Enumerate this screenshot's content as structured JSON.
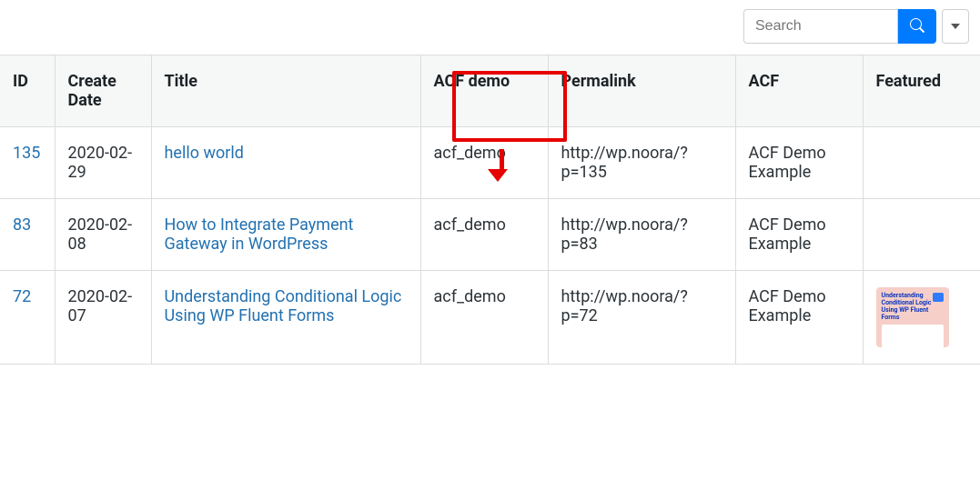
{
  "search": {
    "placeholder": "Search"
  },
  "columns": {
    "id": "ID",
    "create_date": "Create Date",
    "title": "Title",
    "acf_demo": "ACF demo",
    "permalink": "Permalink",
    "acf": "ACF",
    "featured": "Featured"
  },
  "rows": [
    {
      "id": "135",
      "create_date": "2020-02-29",
      "title": "hello world",
      "acf_demo": "acf_demo",
      "permalink": "http://wp.noora/?p=135",
      "acf": "ACF Demo Example",
      "featured_thumb_text": ""
    },
    {
      "id": "83",
      "create_date": "2020-02-08",
      "title": "How to Integrate Payment Gateway in WordPress",
      "acf_demo": "acf_demo",
      "permalink": "http://wp.noora/?p=83",
      "acf": "ACF Demo Example",
      "featured_thumb_text": ""
    },
    {
      "id": "72",
      "create_date": "2020-02-07",
      "title": "Understanding Conditional Logic Using WP Fluent Forms",
      "acf_demo": "acf_demo",
      "permalink": "http://wp.noora/?p=72",
      "acf": "ACF Demo Example",
      "featured_thumb_text": "Understanding Conditional Logic Using WP Fluent Forms"
    }
  ],
  "annotation": {
    "color": "#e60000"
  }
}
